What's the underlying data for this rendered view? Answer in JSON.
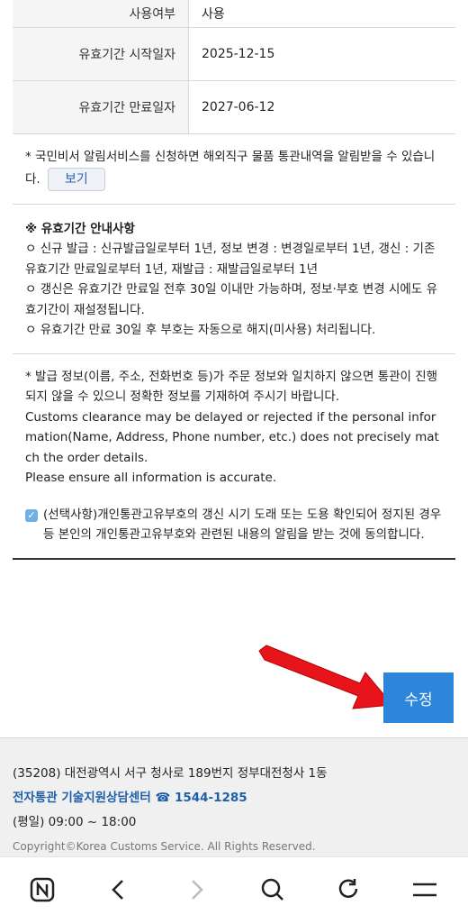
{
  "table": {
    "rows": [
      {
        "label": "사용여부",
        "value": "사용"
      },
      {
        "label": "유효기간 시작일자",
        "value": "2025-12-15"
      },
      {
        "label": "유효기간 만료일자",
        "value": "2027-06-12"
      }
    ]
  },
  "notice": {
    "text": "* 국민비서 알림서비스를 신청하면 해외직구 물품 통관내역을 알림받을 수 있습니다.",
    "view_button": "보기"
  },
  "guide": {
    "title": "※ 유효기간 안내사항",
    "line1": "ㅇ 신규 발급 : 신규발급일로부터 1년, 정보 변경 : 변경일로부터 1년, 갱신 : 기존 유효기간 만료일로부터 1년, 재발급 : 재발급일로부터 1년",
    "line2": "ㅇ 갱신은 유효기간 만료일 전후 30일 이내만 가능하며, 정보·부호 변경 시에도 유효기간이 재설정됩니다.",
    "line3": "ㅇ 유효기간 만료 30일 후 부호는 자동으로 해지(미사용) 처리됩니다."
  },
  "info": {
    "korean": "* 발급 정보(이름, 주소, 전화번호 등)가 주문 정보와 일치하지 않으면 통관이 진행되지 않을 수 있으니 정확한 정보를 기재하여 주시기 바랍니다.",
    "english1": "Customs clearance may be delayed or rejected if the personal information(Name, Address, Phone number, etc.) does not precisely match the order details.",
    "english2": "Please ensure all information is accurate."
  },
  "consent": {
    "checked": true,
    "text": "(선택사항)개인통관고유부호의 갱신 시기 도래 또는 도용 확인되어 정지된 경우 등 본인의 개인통관고유부호와 관련된 내용의 알림을 받는 것에 동의합니다."
  },
  "actions": {
    "save_label": "수정"
  },
  "footer": {
    "address": "(35208) 대전광역시 서구 청사로 189번지 정부대전청사 1동",
    "support_center": "전자통관 기술지원상담센터 ☎ 1544-1285",
    "hours": "(평일) 09:00 ~ 18:00",
    "copyright": "Copyright©Korea Customs Service. All Rights Reserved."
  },
  "toolbar": {
    "icons": [
      "naver-home-icon",
      "back-icon",
      "forward-icon",
      "search-icon",
      "refresh-icon",
      "menu-icon"
    ]
  },
  "colors": {
    "primary_button": "#2d86d9",
    "annotation_arrow": "#e8141b"
  }
}
